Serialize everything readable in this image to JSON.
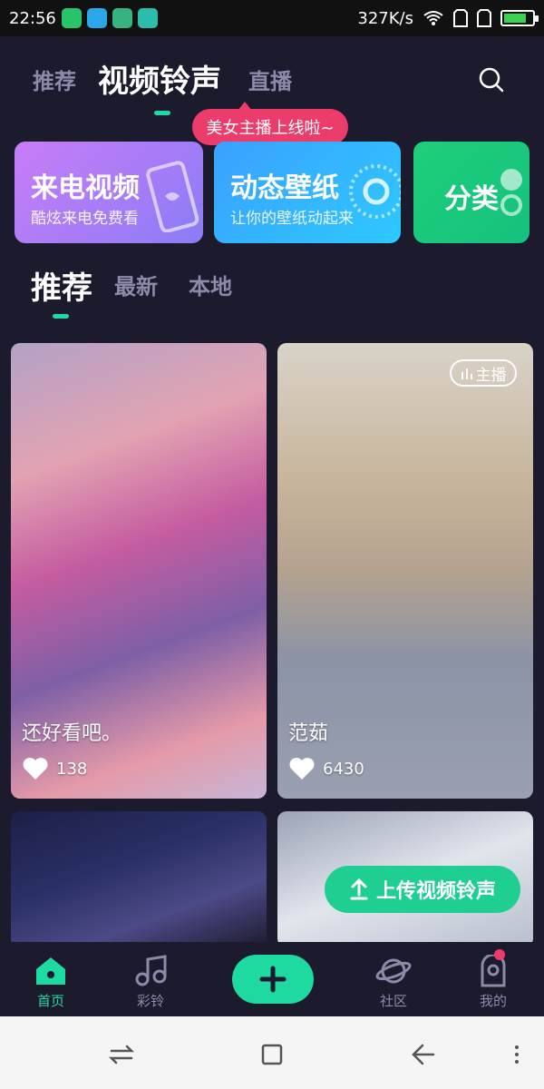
{
  "status_bar": {
    "time": "22:56",
    "speed": "327K/s",
    "battery_level_percent": 80,
    "app_icons": [
      "green-app-icon",
      "blue-app-icon",
      "map-app-icon",
      "usb-icon"
    ]
  },
  "top_tabs": {
    "items": [
      {
        "label": "推荐",
        "active": false
      },
      {
        "label": "视频铃声",
        "active": true
      },
      {
        "label": "直播",
        "active": false
      }
    ]
  },
  "live_badge": {
    "text": "美女主播上线啦~"
  },
  "feature_cards": [
    {
      "title": "来电视频",
      "subtitle": "酷炫来电免费看"
    },
    {
      "title": "动态壁纸",
      "subtitle": "让你的壁纸动起来"
    },
    {
      "title": "分类",
      "subtitle": ""
    }
  ],
  "sub_tabs": [
    {
      "label": "推荐",
      "active": true
    },
    {
      "label": "最新",
      "active": false
    },
    {
      "label": "本地",
      "active": false
    }
  ],
  "videos": [
    {
      "title": "还好看吧。",
      "likes": "138",
      "live": false
    },
    {
      "title": "范茹",
      "likes": "6430",
      "live": true,
      "live_label": "主播"
    },
    {
      "title": "",
      "likes": "",
      "live": false
    },
    {
      "title": "",
      "likes": "",
      "live": false
    }
  ],
  "upload_button": {
    "label": "上传视频铃声"
  },
  "bottom_nav": [
    {
      "label": "首页",
      "active": true,
      "icon": "home-icon"
    },
    {
      "label": "彩铃",
      "active": false,
      "icon": "music-icon"
    },
    {
      "label": "",
      "active": false,
      "icon": "plus-icon"
    },
    {
      "label": "社区",
      "active": false,
      "icon": "planet-icon"
    },
    {
      "label": "我的",
      "active": false,
      "icon": "profile-icon"
    }
  ],
  "colors": {
    "background": "#1c1b2e",
    "accent": "#1ed9a0",
    "badge": "#ec3c6b",
    "inactive_text": "#8b8aa8"
  }
}
